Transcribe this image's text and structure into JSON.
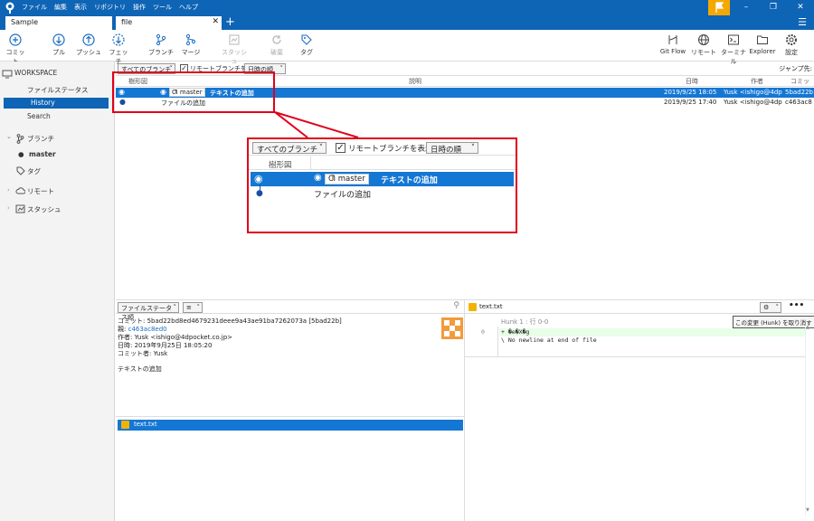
{
  "titlebar": {
    "menu": [
      "ファイル",
      "編集",
      "表示",
      "リポジトリ",
      "操作",
      "ツール",
      "ヘルプ"
    ],
    "flag_color": "#f6a800"
  },
  "tabs": [
    {
      "label": "Sample"
    },
    {
      "label": "file"
    }
  ],
  "toolbar": {
    "left": [
      {
        "label": "コミット",
        "icon": "commit-icon"
      },
      {
        "label": "プル",
        "icon": "pull-icon"
      },
      {
        "label": "プッシュ",
        "icon": "push-icon"
      },
      {
        "label": "フェッチ",
        "icon": "fetch-icon"
      },
      {
        "label": "ブランチ",
        "icon": "branch-icon"
      },
      {
        "label": "マージ",
        "icon": "merge-icon"
      },
      {
        "label": "スタッシュ",
        "icon": "stash-icon"
      },
      {
        "label": "破棄",
        "icon": "discard-icon"
      },
      {
        "label": "タグ",
        "icon": "tag-icon"
      }
    ],
    "right": [
      {
        "label": "Git Flow",
        "icon": "git-flow-icon"
      },
      {
        "label": "リモート",
        "icon": "globe-icon"
      },
      {
        "label": "ターミナル",
        "icon": "terminal-icon"
      },
      {
        "label": "Explorer",
        "icon": "folder-icon"
      },
      {
        "label": "設定",
        "icon": "gear-icon"
      }
    ]
  },
  "sidebar": {
    "workspace": "WORKSPACE",
    "file_status": "ファイルステータス",
    "history": "History",
    "search": "Search",
    "branches": "ブランチ",
    "master": "master",
    "tags": "タグ",
    "remotes": "リモート",
    "stashes": "スタッシュ"
  },
  "filters": {
    "branches": "すべてのブランチ",
    "show_remote": "リモートブランチを表示",
    "order": "日時の順",
    "jump": "ジャンプ先:"
  },
  "columns": {
    "graph": "樹形図",
    "desc": "説明",
    "date": "日時",
    "author": "作者",
    "commit": "コミット"
  },
  "commits": [
    {
      "branch": "master",
      "message": "テキストの追加",
      "date": "2019/9/25 18:05",
      "author": "Yusk <ishigo@4dp",
      "hash": "5bad22b"
    },
    {
      "message": "ファイルの追加",
      "date": "2019/9/25 17:40",
      "author": "Yusk <ishigo@4dp",
      "hash": "c463ac8"
    }
  ],
  "details": {
    "sort": "ファイルステータス順",
    "commit_line": "コミット: 5bad22bd8ed4679231deee9a43ae91ba7262073a [5bad22b]",
    "parent_label": "親:",
    "parent": "c463ac8ed0",
    "author_line": "作者: Yusk <ishigo@4dpocket.co.jp>",
    "date_line": "日時: 2019年9月25日 18:05:20",
    "committer_line": "コミット者: Yusk",
    "message": "テキストの追加",
    "file": "text.txt"
  },
  "diff": {
    "file": "text.txt",
    "hunk": "Hunk 1 : 行 0-0",
    "revert_tooltip": "この変更 (Hunk) を取り消す",
    "line_no": "0",
    "added": "+ �e�X�g",
    "no_newline": "\\  No newline at end of file"
  },
  "colors": {
    "accent": "#0e64b5",
    "selection": "#1477d4",
    "highlight_box": "#e0001b"
  }
}
